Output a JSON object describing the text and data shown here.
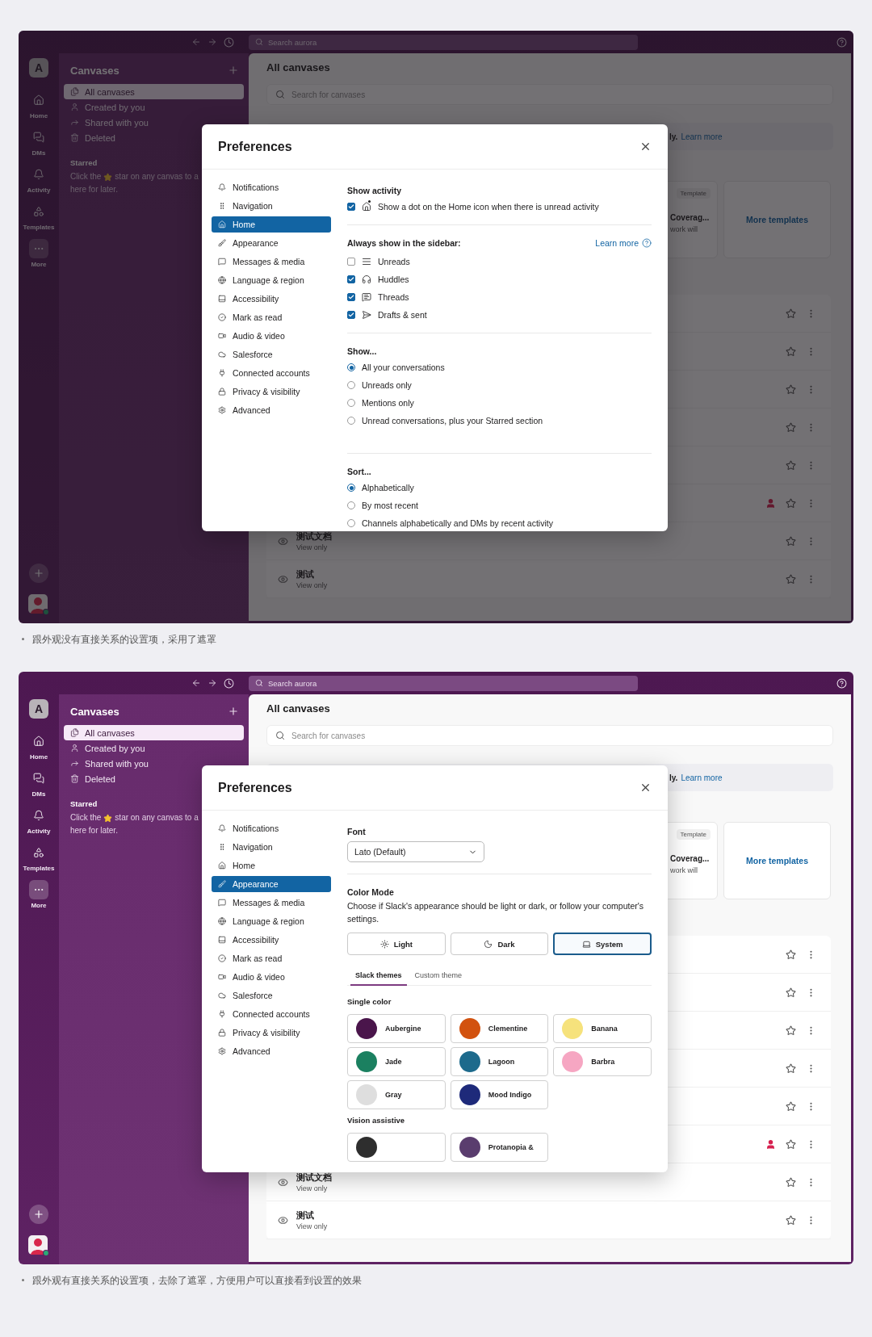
{
  "frames": [
    {
      "masked": true,
      "topbar": {
        "search_placeholder": "Search aurora"
      },
      "rail": {
        "workspace": "A",
        "items": [
          {
            "label": "Home",
            "selected": false
          },
          {
            "label": "DMs",
            "selected": false
          },
          {
            "label": "Activity",
            "selected": false
          },
          {
            "label": "Templates",
            "selected": false
          },
          {
            "label": "More",
            "selected": true
          }
        ]
      },
      "sidebar": {
        "title": "Canvases",
        "items": [
          {
            "label": "All canvases",
            "selected": true
          },
          {
            "label": "Created by you",
            "selected": false
          },
          {
            "label": "Shared with you",
            "selected": false
          },
          {
            "label": "Deleted",
            "selected": false
          }
        ],
        "starred_heading": "Starred",
        "starred_text": [
          "Click the",
          "star on any canvas to a",
          "here for later."
        ]
      },
      "main": {
        "title": "All canvases",
        "search_placeholder": "Search for canvases",
        "banner": {
          "text": "ly.",
          "link": "Learn more"
        },
        "template_card": {
          "badge": "Template",
          "title": "Coverag...",
          "subtitle": "work will"
        },
        "more_templates": "More templates",
        "rows": [
          {
            "shared": false
          },
          {
            "shared": false
          },
          {
            "shared": false
          },
          {
            "shared": false
          },
          {
            "shared": false
          },
          {
            "shared": true
          },
          {
            "shared": false,
            "title": "测试文档",
            "subtitle": "View only"
          },
          {
            "shared": false,
            "title": "测试",
            "subtitle": "View only"
          }
        ]
      },
      "modal": {
        "title": "Preferences",
        "nav": [
          {
            "label": "Notifications",
            "selected": false
          },
          {
            "label": "Navigation",
            "selected": false
          },
          {
            "label": "Home",
            "selected": true
          },
          {
            "label": "Appearance",
            "selected": false
          },
          {
            "label": "Messages & media",
            "selected": false
          },
          {
            "label": "Language & region",
            "selected": false
          },
          {
            "label": "Accessibility",
            "selected": false
          },
          {
            "label": "Mark as read",
            "selected": false
          },
          {
            "label": "Audio & video",
            "selected": false
          },
          {
            "label": "Salesforce",
            "selected": false
          },
          {
            "label": "Connected accounts",
            "selected": false
          },
          {
            "label": "Privacy & visibility",
            "selected": false
          },
          {
            "label": "Advanced",
            "selected": false
          }
        ],
        "panel": {
          "kind": "home",
          "show_activity": {
            "heading": "Show activity",
            "label": "Show a dot on the Home icon when there is unread activity",
            "checked": true
          },
          "sidebar_section": {
            "heading": "Always show in the sidebar:",
            "link": "Learn more",
            "items": [
              {
                "label": "Unreads",
                "checked": false
              },
              {
                "label": "Huddles",
                "checked": true
              },
              {
                "label": "Threads",
                "checked": true
              },
              {
                "label": "Drafts & sent",
                "checked": true
              }
            ]
          },
          "show": {
            "heading": "Show...",
            "options": [
              {
                "label": "All your conversations",
                "selected": true
              },
              {
                "label": "Unreads only",
                "selected": false
              },
              {
                "label": "Mentions only",
                "selected": false
              },
              {
                "label": "Unread conversations, plus your Starred section",
                "selected": false
              }
            ]
          },
          "sort": {
            "heading": "Sort...",
            "options": [
              {
                "label": "Alphabetically",
                "selected": true
              },
              {
                "label": "By most recent",
                "selected": false
              },
              {
                "label": "Channels alphabetically and DMs by recent activity",
                "selected": false
              }
            ]
          }
        }
      },
      "caption": "跟外观没有直接关系的设置项，采用了遮罩"
    },
    {
      "masked": false,
      "topbar": {
        "search_placeholder": "Search aurora"
      },
      "rail": {
        "workspace": "A",
        "items": [
          {
            "label": "Home",
            "selected": false
          },
          {
            "label": "DMs",
            "selected": false
          },
          {
            "label": "Activity",
            "selected": false
          },
          {
            "label": "Templates",
            "selected": false
          },
          {
            "label": "More",
            "selected": true
          }
        ]
      },
      "sidebar": {
        "title": "Canvases",
        "items": [
          {
            "label": "All canvases",
            "selected": true
          },
          {
            "label": "Created by you",
            "selected": false
          },
          {
            "label": "Shared with you",
            "selected": false
          },
          {
            "label": "Deleted",
            "selected": false
          }
        ],
        "starred_heading": "Starred",
        "starred_text": [
          "Click the",
          "star on any canvas to a",
          "here for later."
        ]
      },
      "main": {
        "title": "All canvases",
        "search_placeholder": "Search for canvases",
        "banner": {
          "text": "ly.",
          "link": "Learn more"
        },
        "template_card": {
          "badge": "Template",
          "title": "Coverag...",
          "subtitle": "work will"
        },
        "more_templates": "More templates",
        "rows": [
          {
            "shared": false
          },
          {
            "shared": false
          },
          {
            "shared": false
          },
          {
            "shared": false
          },
          {
            "shared": false
          },
          {
            "shared": true
          },
          {
            "shared": false,
            "title": "测试文档",
            "subtitle": "View only"
          },
          {
            "shared": false,
            "title": "测试",
            "subtitle": "View only"
          }
        ]
      },
      "modal": {
        "title": "Preferences",
        "nav": [
          {
            "label": "Notifications",
            "selected": false
          },
          {
            "label": "Navigation",
            "selected": false
          },
          {
            "label": "Home",
            "selected": false
          },
          {
            "label": "Appearance",
            "selected": true
          },
          {
            "label": "Messages & media",
            "selected": false
          },
          {
            "label": "Language & region",
            "selected": false
          },
          {
            "label": "Accessibility",
            "selected": false
          },
          {
            "label": "Mark as read",
            "selected": false
          },
          {
            "label": "Audio & video",
            "selected": false
          },
          {
            "label": "Salesforce",
            "selected": false
          },
          {
            "label": "Connected accounts",
            "selected": false
          },
          {
            "label": "Privacy & visibility",
            "selected": false
          },
          {
            "label": "Advanced",
            "selected": false
          }
        ],
        "panel": {
          "kind": "appearance",
          "font": {
            "heading": "Font",
            "value": "Lato (Default)"
          },
          "color_mode": {
            "heading": "Color Mode",
            "description": "Choose if Slack's appearance should be light or dark, or follow your computer's settings.",
            "modes": [
              {
                "label": "Light",
                "selected": false
              },
              {
                "label": "Dark",
                "selected": false
              },
              {
                "label": "System",
                "selected": true
              }
            ]
          },
          "theme_tabs": [
            {
              "label": "Slack themes",
              "selected": true
            },
            {
              "label": "Custom theme",
              "selected": false
            }
          ],
          "single_color": {
            "heading": "Single color",
            "swatches": [
              {
                "label": "Aubergine",
                "color": "#4a154b"
              },
              {
                "label": "Clementine",
                "color": "#d2520f"
              },
              {
                "label": "Banana",
                "color": "#f6e27c"
              },
              {
                "label": "Jade",
                "color": "#1b8060"
              },
              {
                "label": "Lagoon",
                "color": "#1d6a8c"
              },
              {
                "label": "Barbra",
                "color": "#f6a6c2"
              },
              {
                "label": "Gray",
                "color": "#dedede"
              },
              {
                "label": "Mood Indigo",
                "color": "#1e2a7a"
              }
            ]
          },
          "vision_assistive": {
            "heading": "Vision assistive",
            "swatches": [
              {
                "color": "#2e2e2e"
              },
              {
                "label": "Protanopia &",
                "color": "#5a3d6e"
              }
            ]
          }
        }
      },
      "caption": "跟外观有直接关系的设置项，去除了遮罩，方便用户可以直接看到设置的效果"
    }
  ]
}
